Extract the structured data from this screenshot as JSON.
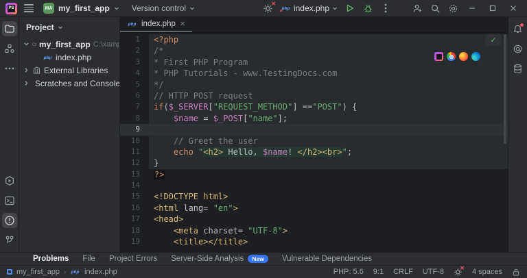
{
  "accent": {
    "blue": "#3574f0",
    "green": "#57965c",
    "red": "#f75464"
  },
  "toolbar": {
    "app_logo_text": "PS",
    "project_badge": "MA",
    "project_name": "my_first_app",
    "vcs_label": "Version control",
    "run_config_name": "index.php"
  },
  "project_panel": {
    "header": "Project",
    "root_name": "my_first_app",
    "root_path": "C:\\xampp\\htdocs",
    "file_php": "index.php",
    "external_libs": "External Libraries",
    "scratches": "Scratches and Consoles"
  },
  "editor": {
    "tab_name": "index.php",
    "tab_close": "✕",
    "inspection_check": "✔",
    "browser_icons": [
      "phpstorm-preview",
      "chrome",
      "firefox",
      "edge"
    ]
  },
  "code": {
    "caret_line": 9,
    "lines": [
      {
        "n": 1,
        "r": "php",
        "s": [
          [
            "o",
            "<?php"
          ]
        ]
      },
      {
        "n": 2,
        "r": "php",
        "s": [
          [
            "c",
            "/*"
          ]
        ]
      },
      {
        "n": 3,
        "r": "php",
        "s": [
          [
            "c",
            "* First PHP Program"
          ]
        ]
      },
      {
        "n": 4,
        "r": "php",
        "s": [
          [
            "c",
            "* PHP Tutorials - www.TestingDocs.com"
          ]
        ]
      },
      {
        "n": 5,
        "r": "php",
        "s": [
          [
            "c",
            "*/"
          ]
        ]
      },
      {
        "n": 6,
        "r": "php",
        "s": [
          [
            "c",
            "// HTTP POST request"
          ]
        ]
      },
      {
        "n": 7,
        "r": "php",
        "s": [
          [
            "o",
            "if"
          ],
          [
            "d",
            "("
          ],
          [
            "v",
            "$_SERVER"
          ],
          [
            "d",
            "["
          ],
          [
            "s",
            "\"REQUEST_METHOD\""
          ],
          [
            "d",
            "] =="
          ],
          [
            "s",
            "\"POST\""
          ],
          [
            "d",
            ") {"
          ]
        ]
      },
      {
        "n": 8,
        "r": "php",
        "s": [
          [
            "d",
            "    "
          ],
          [
            "v",
            "$name"
          ],
          [
            "d",
            " = "
          ],
          [
            "v",
            "$_POST"
          ],
          [
            "d",
            "["
          ],
          [
            "s",
            "\"name\""
          ],
          [
            "d",
            "];"
          ]
        ]
      },
      {
        "n": 9,
        "r": "php",
        "s": []
      },
      {
        "n": 10,
        "r": "php",
        "s": [
          [
            "d",
            "    "
          ],
          [
            "c",
            "// Greet the user"
          ]
        ]
      },
      {
        "n": 11,
        "r": "php",
        "s": [
          [
            "d",
            "    "
          ],
          [
            "o",
            "echo "
          ],
          [
            "s",
            "\""
          ],
          [
            "y",
            "<h2>",
            1
          ],
          [
            "d",
            " Hello, ",
            1
          ],
          [
            "v",
            "$name",
            1
          ],
          [
            "d",
            "! ",
            1
          ],
          [
            "y",
            "</h2><br>",
            1
          ],
          [
            "s",
            "\""
          ],
          [
            "d",
            ";"
          ]
        ]
      },
      {
        "n": 12,
        "r": "php",
        "s": [
          [
            "d",
            "}"
          ]
        ]
      },
      {
        "n": 13,
        "r": "html",
        "s": [
          [
            "o",
            "?>",
            2
          ]
        ]
      },
      {
        "n": 14,
        "r": "html",
        "s": []
      },
      {
        "n": 15,
        "r": "html",
        "s": [
          [
            "y",
            "<!DOCTYPE html>"
          ]
        ]
      },
      {
        "n": 16,
        "r": "html",
        "s": [
          [
            "y",
            "<html"
          ],
          [
            "d",
            " lang= "
          ],
          [
            "s",
            "\"en\""
          ],
          [
            "y",
            ">"
          ]
        ]
      },
      {
        "n": 17,
        "r": "html",
        "s": [
          [
            "y",
            "<head>"
          ]
        ]
      },
      {
        "n": 18,
        "r": "html",
        "s": [
          [
            "d",
            "    "
          ],
          [
            "y",
            "<meta"
          ],
          [
            "d",
            " charset= "
          ],
          [
            "s",
            "\"UTF-8\""
          ],
          [
            "y",
            ">"
          ]
        ]
      },
      {
        "n": 19,
        "r": "html",
        "s": [
          [
            "d",
            "    "
          ],
          [
            "y",
            "<title></title>"
          ]
        ]
      }
    ]
  },
  "problems_bar": {
    "tabs": [
      {
        "label": "Problems",
        "active": true
      },
      {
        "label": "File"
      },
      {
        "label": "Project Errors"
      },
      {
        "label": "Server-Side Analysis",
        "badge": "New"
      },
      {
        "label": "Vulnerable Dependencies"
      }
    ]
  },
  "status_bar": {
    "crumb_project": "my_first_app",
    "crumb_sep": "›",
    "crumb_file": "index.php",
    "php_version": "PHP: 5.6",
    "caret_position": "9:1",
    "line_separator": "CRLF",
    "encoding": "UTF-8",
    "indent": "4 spaces"
  }
}
